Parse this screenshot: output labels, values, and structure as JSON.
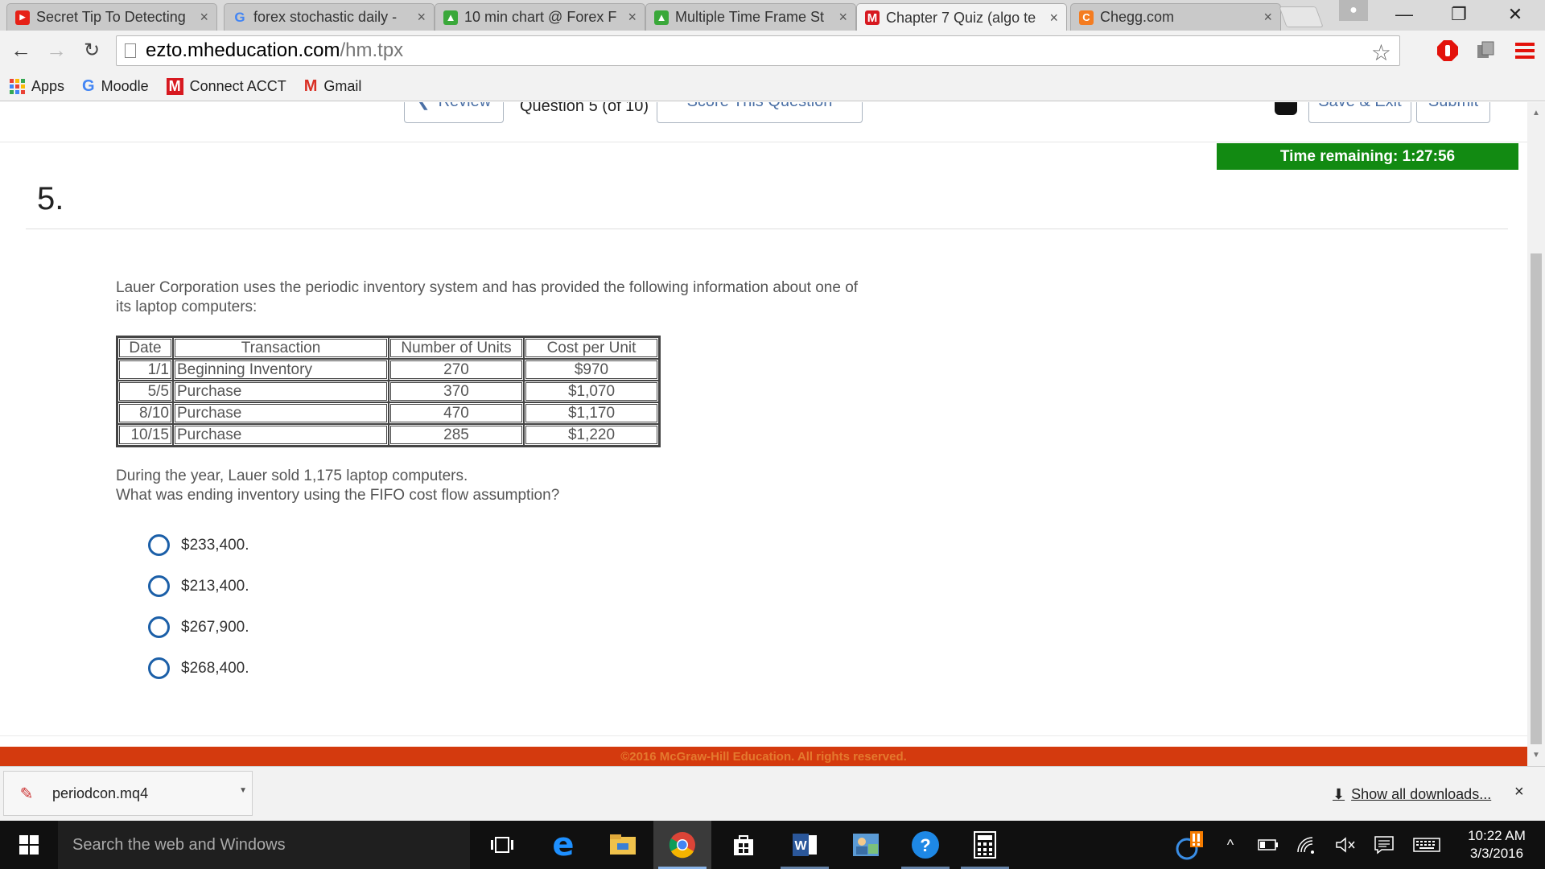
{
  "browser": {
    "tabs": [
      {
        "label": "Secret Tip To Detecting",
        "icon": "youtube-icon",
        "active": false
      },
      {
        "label": "forex stochastic daily -",
        "icon": "google-icon",
        "active": false
      },
      {
        "label": "10 min chart @ Forex F",
        "icon": "chart-icon",
        "active": false
      },
      {
        "label": "Multiple Time Frame St",
        "icon": "chart-icon",
        "active": false
      },
      {
        "label": "Chapter 7 Quiz (algo te",
        "icon": "mcgraw-hill-icon",
        "active": true
      },
      {
        "label": "Chegg.com",
        "icon": "chegg-icon",
        "active": false
      }
    ],
    "tab_close": "×",
    "url_host": "ezto.mheducation.com",
    "url_path": "/hm.tpx",
    "bookmarks": [
      {
        "label": "Apps",
        "icon": "apps-grid-icon"
      },
      {
        "label": "Moodle",
        "icon": "google-icon",
        "glyph": "G"
      },
      {
        "label": "Connect ACCT",
        "icon": "mcgraw-hill-icon",
        "glyph": "M"
      },
      {
        "label": "Gmail",
        "icon": "gmail-icon",
        "glyph": "M"
      }
    ]
  },
  "quiz": {
    "nav": {
      "review_label": "Review",
      "question_counter": "Question 5 (of 10)",
      "score_label": "Score This Question",
      "save_exit_label": "Save & Exit",
      "submit_label": "Submit"
    },
    "timer": "Time remaining: 1:27:56",
    "question_number": "5.",
    "intro": "Lauer Corporation uses the periodic inventory system and has provided the following information about one of its laptop computers:",
    "table": {
      "headers": [
        "Date",
        "Transaction",
        "Number of Units",
        "Cost per Unit"
      ],
      "rows": [
        [
          "1/1",
          "Beginning Inventory",
          "270",
          "$970"
        ],
        [
          "5/5",
          "Purchase",
          "370",
          "$1,070"
        ],
        [
          "8/10",
          "Purchase",
          "470",
          "$1,170"
        ],
        [
          "10/15",
          "Purchase",
          "285",
          "$1,220"
        ]
      ]
    },
    "prompt_line1": "During the year, Lauer sold 1,175 laptop computers.",
    "prompt_line2": "What was ending inventory using the FIFO cost flow assumption?",
    "options": [
      "$233,400.",
      "$213,400.",
      "$267,900.",
      "$268,400."
    ],
    "footer": "©2016 McGraw-Hill Education. All rights reserved."
  },
  "downloads": {
    "file": "periodcon.mq4",
    "show_all": "Show all downloads...",
    "close": "×"
  },
  "taskbar": {
    "search_placeholder": "Search the web and Windows",
    "time": "10:22 AM",
    "date": "3/3/2016"
  },
  "colors": {
    "timer_green": "#128a12",
    "footer_red": "#d43a0e",
    "radio_blue": "#1b5fa8",
    "link_blue": "#4a6fa5"
  }
}
